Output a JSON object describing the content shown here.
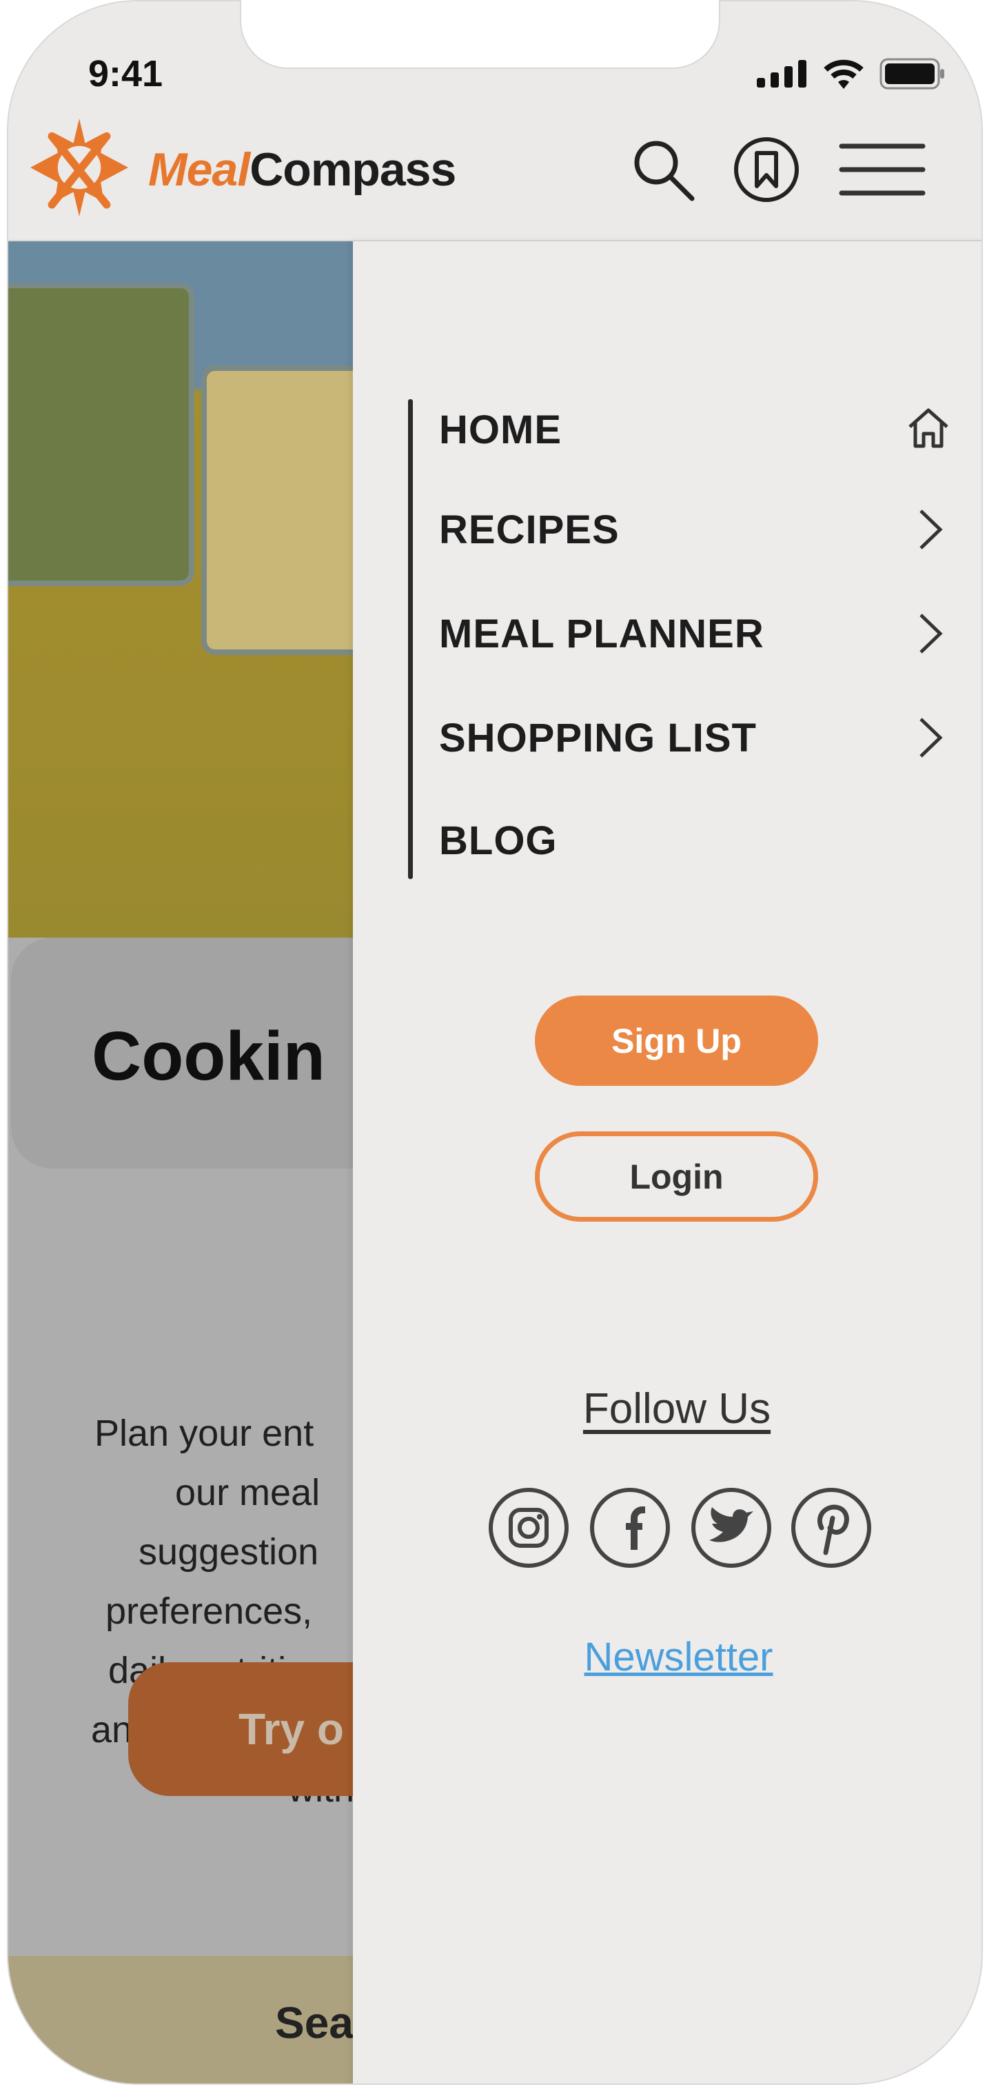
{
  "status_bar": {
    "time": "9:41"
  },
  "header": {
    "brand_part1": "Meal",
    "brand_part2": "Compass",
    "icons": [
      "search-icon",
      "bookmark-icon",
      "menu-icon"
    ]
  },
  "background_page": {
    "heading": "Cookin",
    "paragraph_lines": [
      "Plan your ent",
      "our meal",
      "suggestion",
      "preferences,",
      "daily nutritio",
      "and put ingre",
      "with"
    ],
    "cta_label": "Try o",
    "section_title": "Sea"
  },
  "menu": {
    "items": [
      {
        "label": "HOME",
        "icon": "home-icon"
      },
      {
        "label": "RECIPES",
        "icon": "chevron-right-icon"
      },
      {
        "label": "MEAL PLANNER",
        "icon": "chevron-right-icon"
      },
      {
        "label": "SHOPPING LIST",
        "icon": "chevron-right-icon"
      },
      {
        "label": "BLOG",
        "icon": ""
      }
    ],
    "signup_label": "Sign Up",
    "login_label": "Login",
    "follow_label": "Follow Us",
    "social": [
      "instagram-icon",
      "facebook-icon",
      "twitter-icon",
      "pinterest-icon"
    ],
    "newsletter_label": "Newsletter"
  },
  "colors": {
    "accent": "#eb8845",
    "link": "#4a9fdc",
    "panel": "#edecea"
  }
}
